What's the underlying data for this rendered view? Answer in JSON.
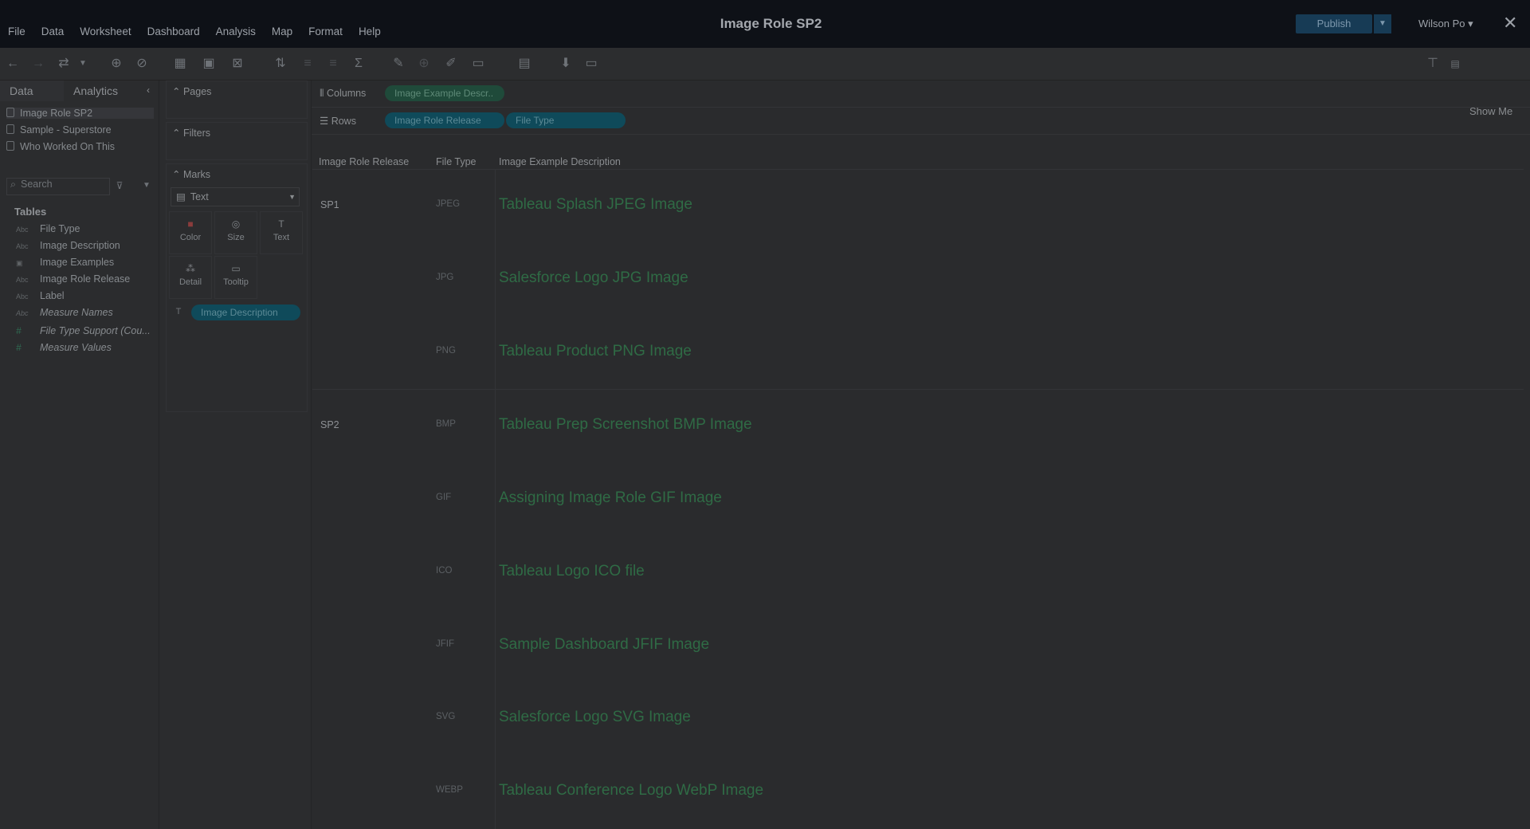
{
  "app": {
    "menu": [
      "File",
      "Data",
      "Worksheet",
      "Dashboard",
      "Analysis",
      "Map",
      "Format",
      "Help"
    ],
    "title": "Image Role SP2",
    "publish_label": "Publish",
    "user": "Wilson Po ▾",
    "show_me": "Show Me"
  },
  "data_pane": {
    "tabs": [
      "Data",
      "Analytics"
    ],
    "datasources": [
      "Image Role SP2",
      "Sample - Superstore",
      "Who Worked On This"
    ],
    "search_placeholder": "Search",
    "tables_heading": "Tables",
    "fields": [
      {
        "type": "Abc",
        "name": "File Type"
      },
      {
        "type": "Abc",
        "name": "Image Description"
      },
      {
        "type": "img",
        "name": "Image Examples"
      },
      {
        "type": "Abc",
        "name": "Image Role Release"
      },
      {
        "type": "Abc",
        "name": "Label"
      },
      {
        "type": "Abc",
        "name": "Measure Names"
      },
      {
        "type": "#",
        "name": "File Type Support (Cou..."
      },
      {
        "type": "#",
        "name": "Measure Values"
      }
    ]
  },
  "cards": {
    "pages": "Pages",
    "filters": "Filters",
    "marks": "Marks",
    "mark_type": "Text",
    "buttons": [
      "Color",
      "Size",
      "Text",
      "Detail",
      "Tooltip"
    ],
    "text_pill": "Image Description"
  },
  "shelves": {
    "columns_label": "Columns",
    "rows_label": "Rows",
    "columns_pill": "Image Example Descr..",
    "rows_pills": [
      "Image Role Release",
      "File Type"
    ]
  },
  "view": {
    "headers": [
      "Image Role Release",
      "File Type",
      "Image Example Description"
    ],
    "groups": [
      {
        "release": "SP1",
        "rows": [
          {
            "file_type": "JPEG",
            "desc": "Tableau Splash JPEG Image"
          },
          {
            "file_type": "JPG",
            "desc": "Salesforce Logo JPG Image"
          },
          {
            "file_type": "PNG",
            "desc": "Tableau Product PNG Image"
          }
        ]
      },
      {
        "release": "SP2",
        "rows": [
          {
            "file_type": "BMP",
            "desc": "Tableau Prep Screenshot BMP Image"
          },
          {
            "file_type": "GIF",
            "desc": "Assigning Image Role GIF Image"
          },
          {
            "file_type": "ICO",
            "desc": "Tableau Logo ICO file"
          },
          {
            "file_type": "JFIF",
            "desc": "Sample Dashboard JFIF Image"
          },
          {
            "file_type": "SVG",
            "desc": "Salesforce Logo SVG Image"
          },
          {
            "file_type": "WEBP",
            "desc": "Tableau Conference Logo WebP Image"
          }
        ]
      }
    ]
  }
}
